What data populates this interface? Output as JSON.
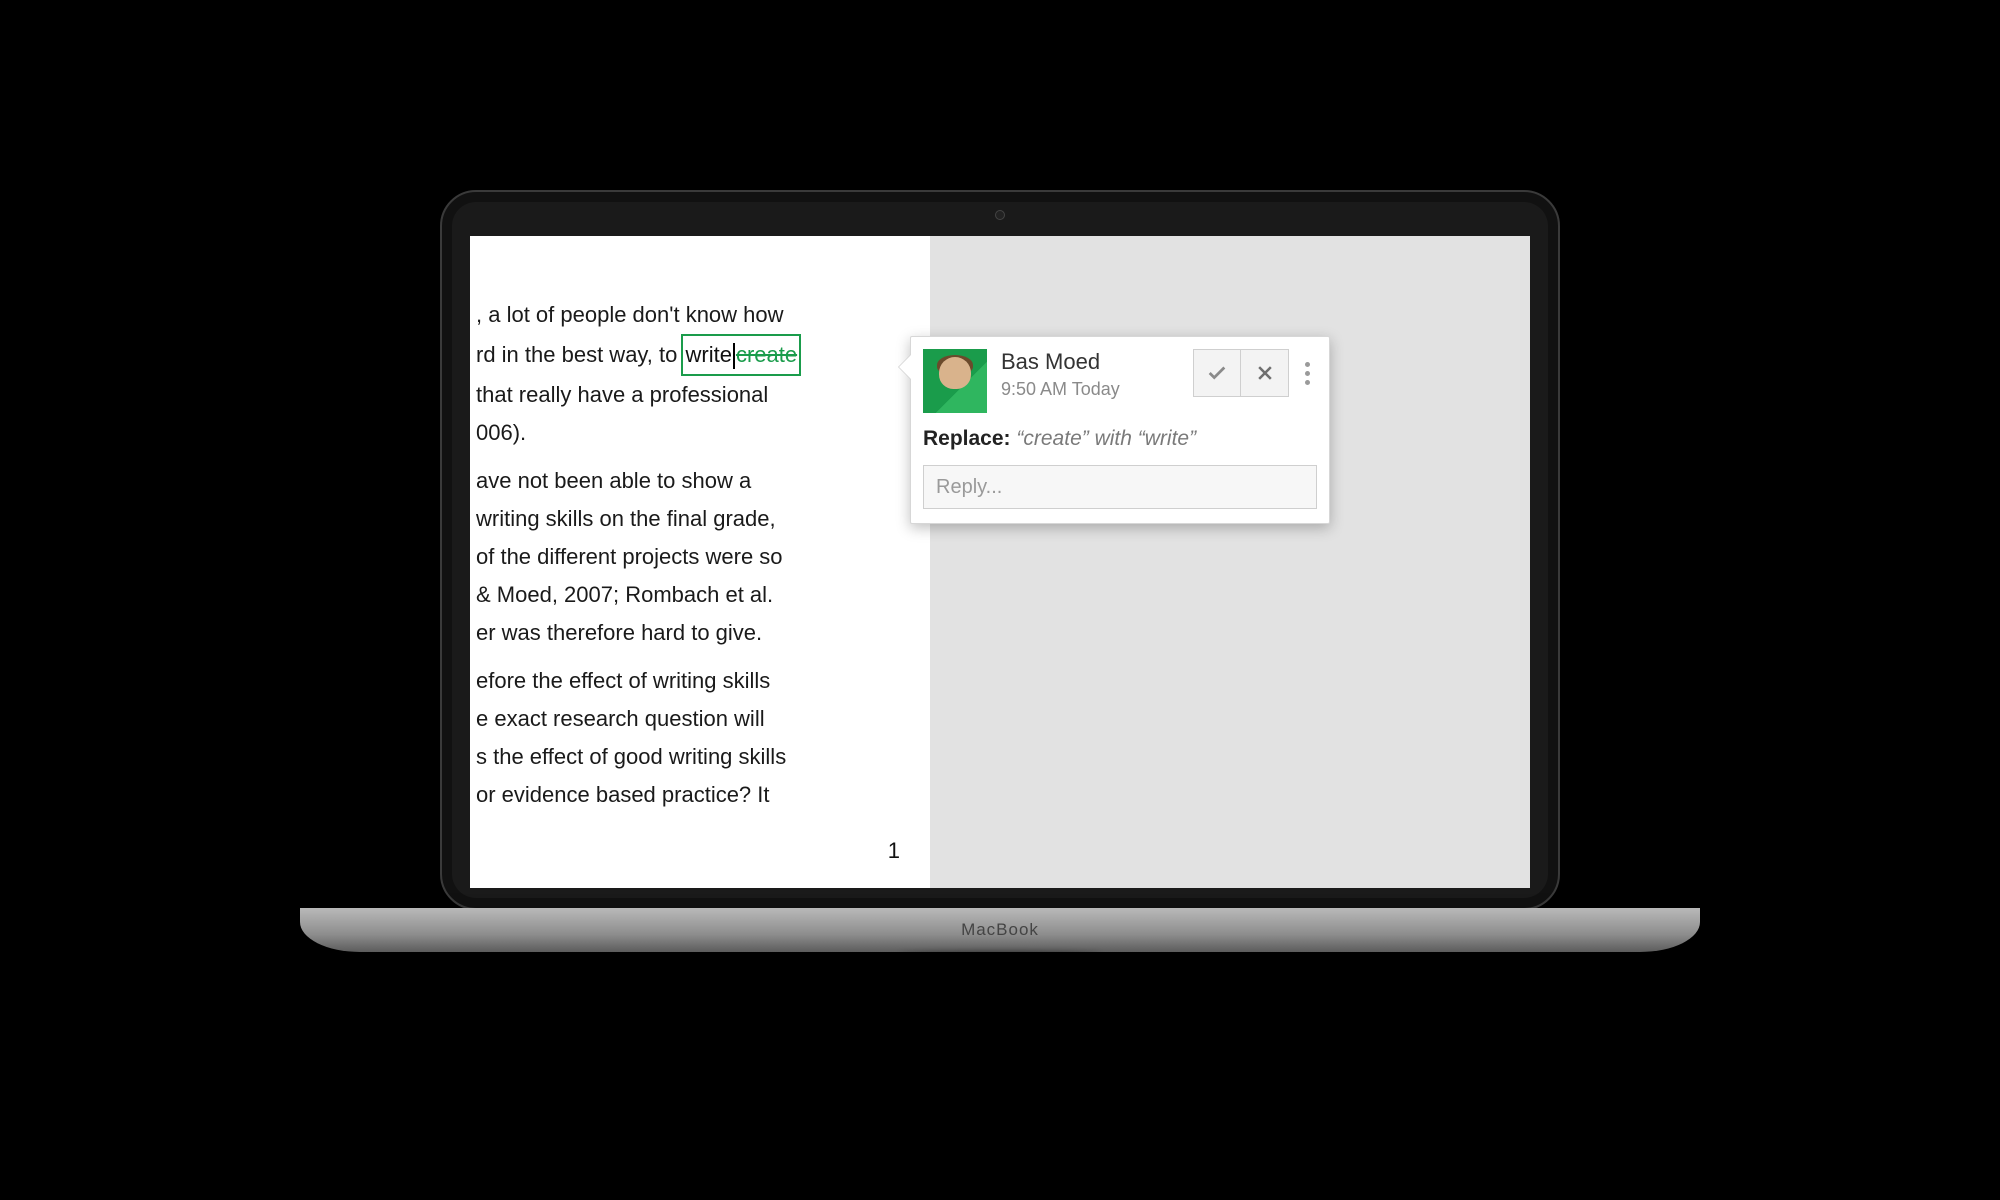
{
  "device": {
    "brand": "MacBook"
  },
  "document": {
    "lines": [
      ", a lot of people don't know how",
      "rd in the best way, to ",
      " that really have a professional",
      "006).",
      "ave not been able to show a",
      " writing skills on the final grade,",
      " of the different projects were so",
      "& Moed, 2007; Rombach et al.",
      "er was therefore hard to give.",
      "efore the effect of writing skills",
      "e exact research question will",
      "s the effect of good writing skills",
      "or evidence based practice? It"
    ],
    "suggestion_inline": {
      "new_word": "write",
      "old_word": "create"
    },
    "page_number": "1"
  },
  "comment": {
    "author": "Bas Moed",
    "timestamp": "9:50 AM Today",
    "label": "Replace:",
    "from_quoted": "“create”",
    "joiner": " with ",
    "to_quoted": "“write”",
    "reply_placeholder": "Reply..."
  }
}
